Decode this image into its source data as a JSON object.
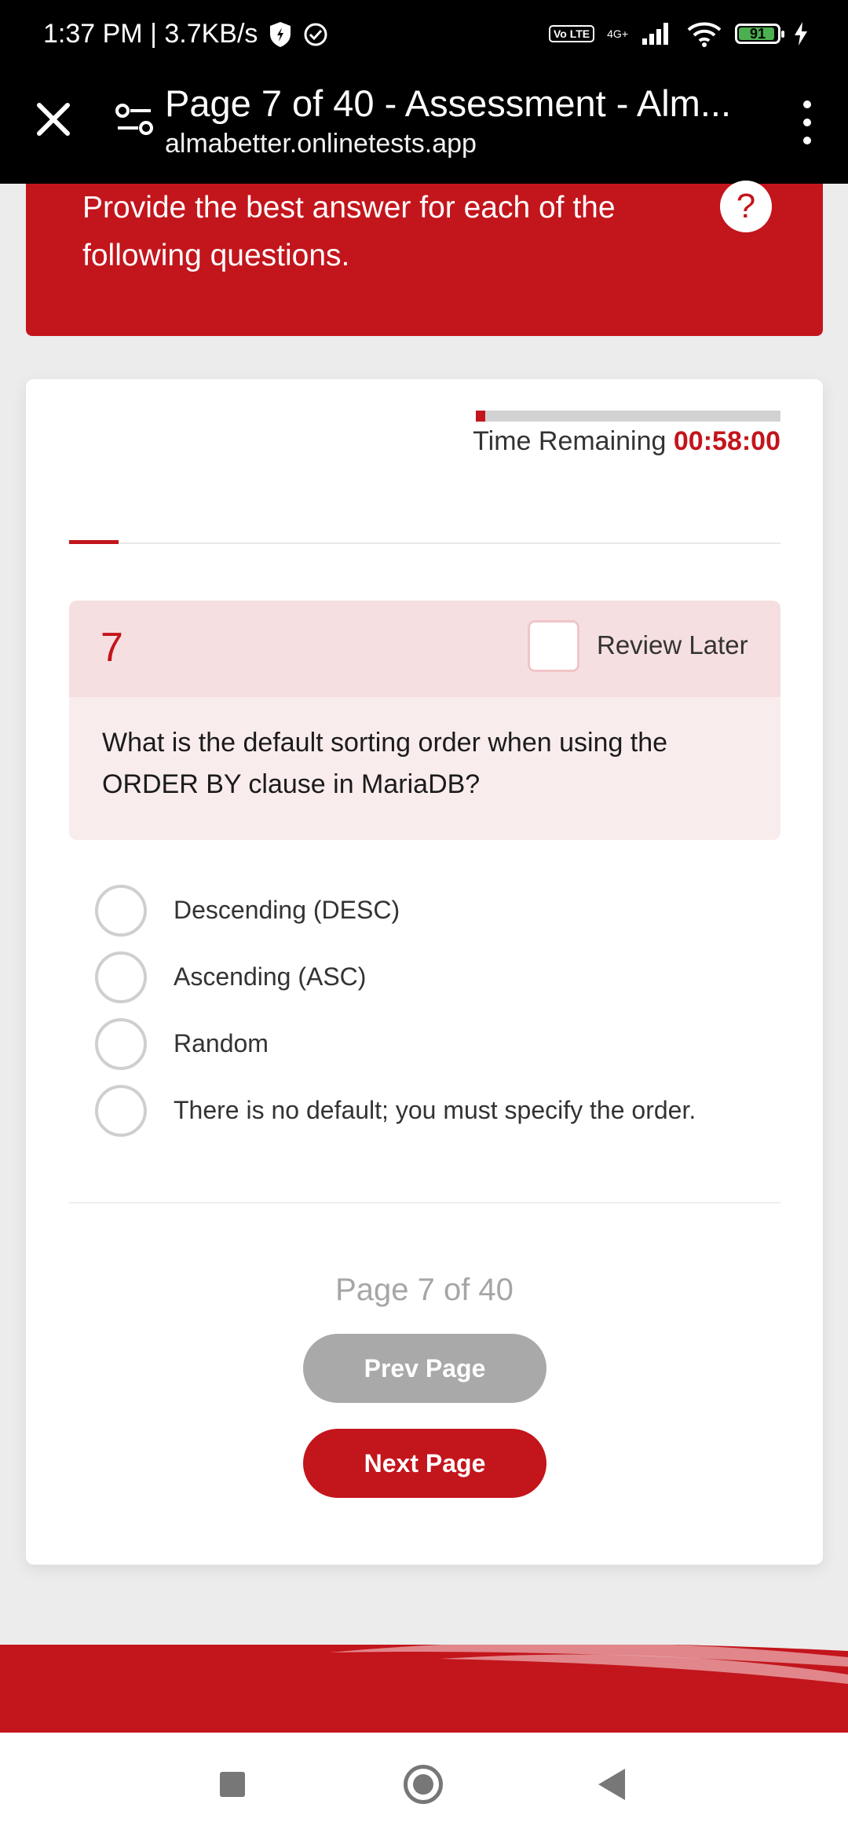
{
  "status_bar": {
    "time_speed": "1:37 PM | 3.7KB/s",
    "volte": "Vo LTE",
    "network": "4G+",
    "battery": "91"
  },
  "browser": {
    "title": "Page 7 of 40 - Assessment - Alm...",
    "url": "almabetter.onlinetests.app"
  },
  "banner": {
    "instructions": "Provide the best answer for each of the following questions.",
    "help_label": "?"
  },
  "timer": {
    "label": "Time Remaining",
    "value": "00:58:00",
    "elapsed_fraction": 0.03
  },
  "progress": {
    "fraction": 0.07
  },
  "question": {
    "number": "7",
    "review_label": "Review Later",
    "text": "What is the default sorting order when using the ORDER BY clause in MariaDB?",
    "options": [
      "Descending (DESC)",
      "Ascending (ASC)",
      "Random",
      "There is no default; you must specify the order."
    ]
  },
  "pagination": {
    "indicator": "Page 7 of 40",
    "prev_label": "Prev Page",
    "next_label": "Next Page"
  },
  "colors": {
    "brand": "#c3151c",
    "muted_button": "#a9a9a9"
  }
}
